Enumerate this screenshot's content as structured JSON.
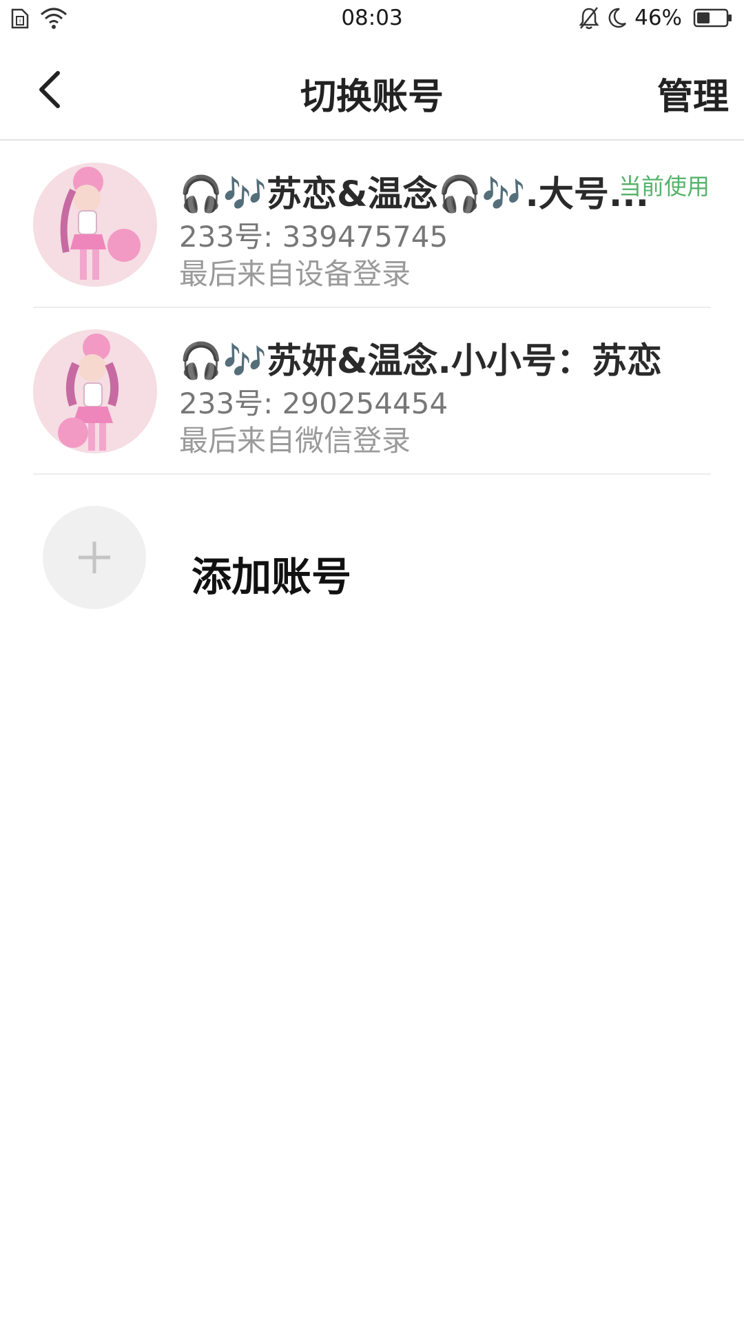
{
  "status_bar": {
    "time": "08:03",
    "battery": "46%",
    "battery_level": 0.46,
    "icons": [
      "sim-icon",
      "wifi-icon",
      "mute-bell-icon",
      "moon-icon",
      "battery-icon"
    ]
  },
  "nav": {
    "title": "切换账号",
    "manage": "管理",
    "back_icon": "back-arrow-icon"
  },
  "accounts": [
    {
      "name": "🎧🎶苏恋&温念🎧🎶.大号...",
      "id": "233号: 339475745",
      "login": "最后来自设备登录",
      "badge": "当前使用"
    },
    {
      "name": "🎧🎶苏妍&温念.小小号：苏恋",
      "id": "233号: 290254454",
      "login": "最后来自微信登录"
    }
  ],
  "add_account": {
    "label": "添加账号",
    "icon": "plus-icon"
  },
  "colors": {
    "badge_green": "#55b36a",
    "divider": "#e2e2e2",
    "avatar_bg": "#f5dde3"
  }
}
